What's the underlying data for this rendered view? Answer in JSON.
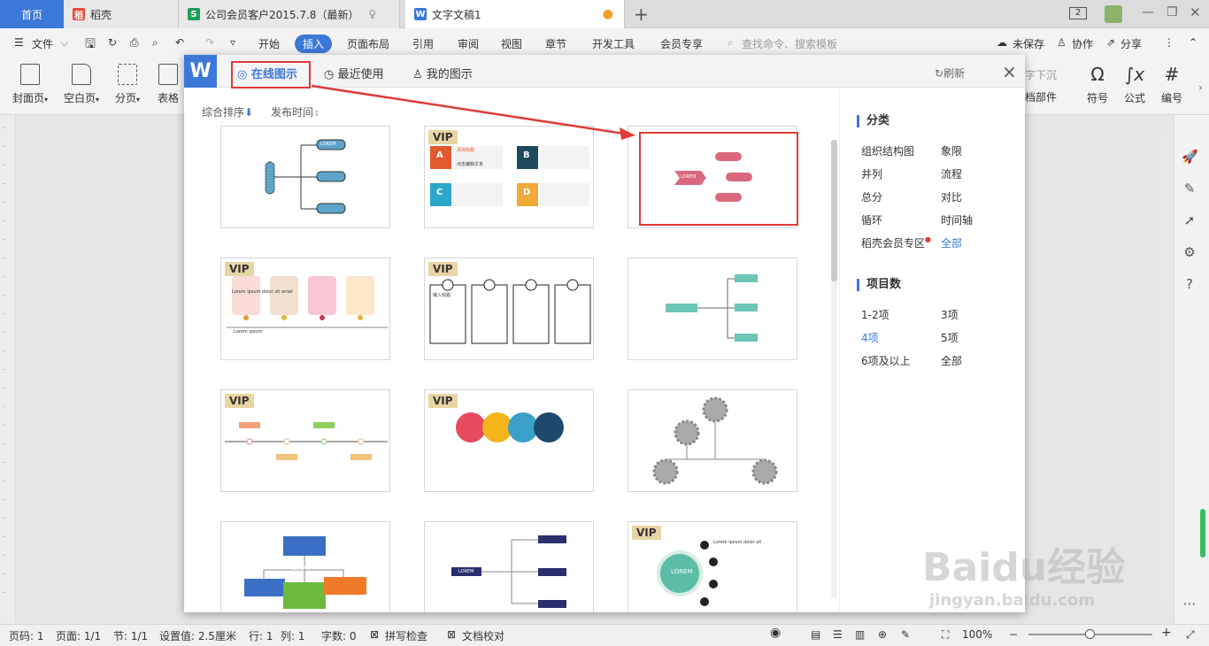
{
  "tabs": {
    "home": "首页",
    "daoke": "稻壳",
    "xls": "公司会员客户2015.7.8（最新）",
    "doc": "文字文稿1",
    "new_tab": "+",
    "page_count": "2"
  },
  "menubar": {
    "file": "文件",
    "items": [
      "开始",
      "插入",
      "页面布局",
      "引用",
      "审阅",
      "视图",
      "章节",
      "开发工具",
      "会员专享"
    ],
    "search_placeholder": "查找命令、搜索模板",
    "unsaved": "未保存",
    "collab": "协作",
    "share": "分享"
  },
  "ribbon": {
    "cover": "封面页",
    "blank": "空白页",
    "break": "分页",
    "table": "表格",
    "partial": "字下沉",
    "docparts": "档部件",
    "symbol": "符号",
    "formula": "公式",
    "numbering": "编号"
  },
  "dialog": {
    "logo": "W",
    "tabs": {
      "online": "在线图示",
      "recent": "最近使用",
      "mine": "我的图示"
    },
    "refresh": "刷新",
    "close": "×",
    "sort": {
      "combined": "综合排序",
      "time": "发布时间"
    },
    "vip": "VIP",
    "card_labels": {
      "lorem": "LOREM",
      "lorem_ipsum": "Lorem ipsum",
      "input_title": "输入标题",
      "add_title": "添加标题",
      "input_text": "点击编辑文本",
      "lorem_dolor": "Lorem ipsum dolor sit amet",
      "lorem_short": "Lorem ipsum dolor sit"
    }
  },
  "panel": {
    "category_title": "分类",
    "categories": [
      "组织结构图",
      "象限",
      "并列",
      "流程",
      "总分",
      "对比",
      "循环",
      "时间轴",
      "稻壳会员专区",
      "全部"
    ],
    "count_title": "项目数",
    "counts": [
      "1-2项",
      "3项",
      "4项",
      "5项",
      "6项及以上",
      "全部"
    ]
  },
  "status": {
    "page_code": "页码: 1",
    "pages": "页面: 1/1",
    "section": "节: 1/1",
    "setting": "设置值: 2.5厘米",
    "row": "行: 1",
    "col": "列: 1",
    "words": "字数: 0",
    "spell": "拼写检查",
    "proof": "文档校对",
    "zoom": "100%"
  },
  "watermark": {
    "brand": "Baidu经验",
    "url": "jingyan.baidu.com"
  },
  "colors": {
    "accent": "#3b78d8",
    "highlight": "#e03a3a",
    "vip_bg": "#e8d5a4"
  }
}
